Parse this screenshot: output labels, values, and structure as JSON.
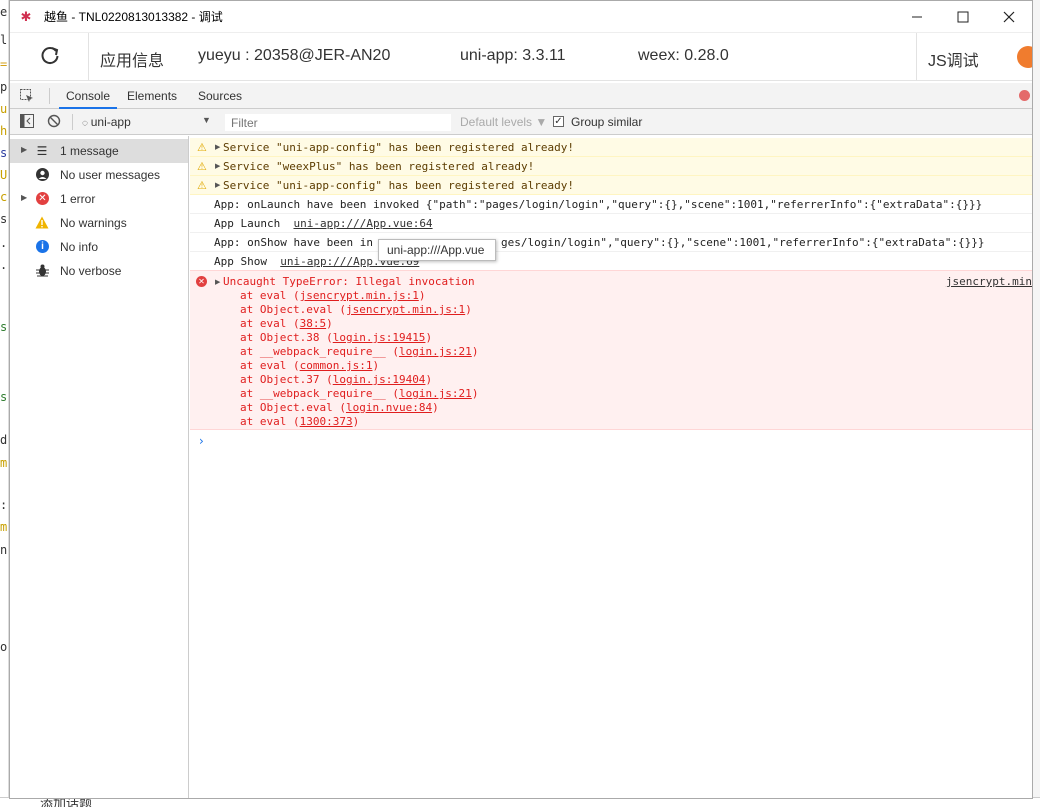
{
  "window": {
    "title": "越鱼 - TNL0220813013382 - 调试"
  },
  "info_bar": {
    "app_info_label": "应用信息",
    "device": "yueyu : 20358@JER-AN20",
    "uniapp_version": "uni-app: 3.3.11",
    "weex_version": "weex: 0.28.0",
    "js_debug_label": "JS调试"
  },
  "tabs": {
    "console": "Console",
    "elements": "Elements",
    "sources": "Sources",
    "active": "Console"
  },
  "toolbar": {
    "context": "uni-app",
    "filter_placeholder": "Filter",
    "levels": "Default levels ▼",
    "group_similar_label": "Group similar",
    "group_similar_checked": true
  },
  "sidebar": {
    "items": [
      {
        "label": "1 message",
        "icon": "list-icon",
        "selected": true
      },
      {
        "label": "No user messages",
        "icon": "user-icon"
      },
      {
        "label": "1 error",
        "icon": "error-icon"
      },
      {
        "label": "No warnings",
        "icon": "warning-icon"
      },
      {
        "label": "No info",
        "icon": "info-icon"
      },
      {
        "label": "No verbose",
        "icon": "bug-icon"
      }
    ]
  },
  "console": {
    "warnings": [
      "Service \"uni-app-config\" has been registered already!",
      "Service \"weexPlus\" has been registered already!",
      "Service \"uni-app-config\" has been registered already!"
    ],
    "logs": [
      {
        "text": "App: onLaunch have been invoked {\"path\":\"pages/login/login\",\"query\":{},\"scene\":1001,\"referrerInfo\":{\"extraData\":{}}}",
        "link": ""
      },
      {
        "text": "App Launch  ",
        "link": "uni-app:///App.vue:64"
      },
      {
        "text": "App: onShow have been in",
        "text_after_tooltip": "ges/login/login\",\"query\":{},\"scene\":1001,\"referrerInfo\":{\"extraData\":{}}}",
        "link": ""
      },
      {
        "text": "App Show  ",
        "link": "uni-app:///App.vue:69"
      }
    ],
    "error": {
      "message": "Uncaught TypeError: Illegal invocation",
      "source": "jsencrypt.min",
      "stack": [
        {
          "fn": "at eval (",
          "loc": "jsencrypt.min.js:1",
          "end": ")"
        },
        {
          "fn": "at Object.eval (",
          "loc": "jsencrypt.min.js:1",
          "end": ")"
        },
        {
          "fn": "at eval (",
          "loc": "38:5",
          "end": ")"
        },
        {
          "fn": "at Object.38 (",
          "loc": "login.js:19415",
          "end": ")"
        },
        {
          "fn": "at __webpack_require__ (",
          "loc": "login.js:21",
          "end": ")"
        },
        {
          "fn": "at eval (",
          "loc": "common.js:1",
          "end": ")"
        },
        {
          "fn": "at Object.37 (",
          "loc": "login.js:19404",
          "end": ")"
        },
        {
          "fn": "at __webpack_require__ (",
          "loc": "login.js:21",
          "end": ")"
        },
        {
          "fn": "at Object.eval (",
          "loc": "login.nvue:84",
          "end": ")"
        },
        {
          "fn": "at eval (",
          "loc": "1300:373",
          "end": ")"
        }
      ]
    },
    "prompt": "›",
    "tooltip": "uni-app:///App.vue"
  },
  "background": {
    "left_chars": [
      "e",
      "l",
      "=",
      "p",
      "u",
      "h",
      "s",
      "U",
      "c",
      "s",
      ".",
      ".",
      "s",
      "s",
      "d",
      "m",
      ":",
      "m",
      "n",
      "o"
    ],
    "bottom_text": "添加话题"
  },
  "colors": {
    "accent": "#1a73e8",
    "error": "#e01e1e",
    "warning_bg": "#fffbe5",
    "error_bg": "#fff0f0",
    "orange": "#f07c2e"
  }
}
